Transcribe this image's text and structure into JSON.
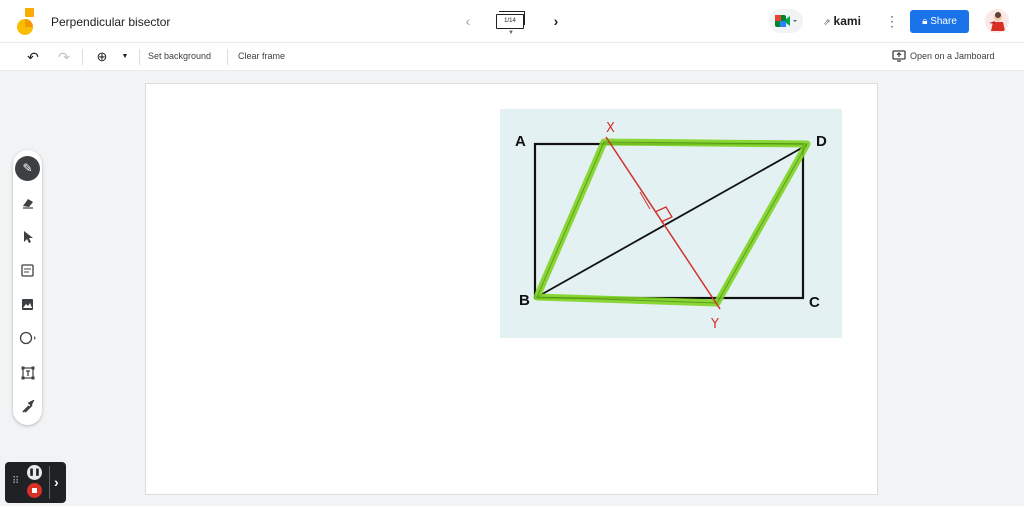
{
  "header": {
    "title": "Perpendicular bisector",
    "frame_counter": "1/14",
    "kami_label": "kami",
    "share_label": "Share"
  },
  "toolbar": {
    "set_background_label": "Set background",
    "clear_frame_label": "Clear frame",
    "open_jamboard_label": "Open on a Jamboard"
  },
  "tools": [
    {
      "name": "pen-icon",
      "active": true
    },
    {
      "name": "eraser-icon",
      "active": false
    },
    {
      "name": "select-arrow-icon",
      "active": false
    },
    {
      "name": "sticky-note-icon",
      "active": false
    },
    {
      "name": "add-image-icon",
      "active": false
    },
    {
      "name": "circle-shape-icon",
      "active": false
    },
    {
      "name": "text-box-icon",
      "active": false
    },
    {
      "name": "laser-icon",
      "active": false
    }
  ],
  "figure": {
    "labels": {
      "a": "A",
      "b": "B",
      "c": "C",
      "d": "D",
      "x": "X",
      "y": "Y"
    }
  },
  "colors": {
    "accent": "#1a73e8",
    "highlight": "#7ed321",
    "annotation": "#d0312d",
    "record": "#d93025"
  }
}
